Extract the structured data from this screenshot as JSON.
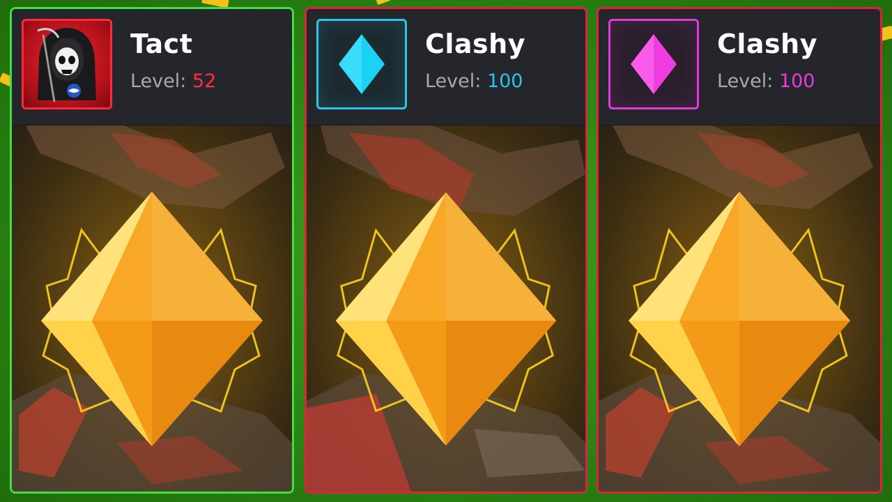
{
  "cards": [
    {
      "player_name": "Tact",
      "level_label": "Level: ",
      "level_value": "52",
      "level_color": "#ff2f43",
      "avatar_icon": "grim-reaper-skull-icon",
      "card_border_color": "#3ee043",
      "reward_icon": "gold-diamond-icon"
    },
    {
      "player_name": "Clashy",
      "level_label": "Level: ",
      "level_value": "100",
      "level_color": "#2ac6e8",
      "avatar_icon": "cyan-diamond-icon",
      "card_border_color": "#e0233a",
      "reward_icon": "gold-diamond-icon"
    },
    {
      "player_name": "Clashy",
      "level_label": "Level: ",
      "level_value": "100",
      "level_color": "#ec3ade",
      "avatar_icon": "magenta-diamond-icon",
      "card_border_color": "#e0233a",
      "reward_icon": "gold-diamond-icon"
    }
  ],
  "colors": {
    "background": "#2d8a14",
    "card_background": "#1e2024",
    "label_gray": "#a7a9ae",
    "gold": "#f5a623"
  }
}
